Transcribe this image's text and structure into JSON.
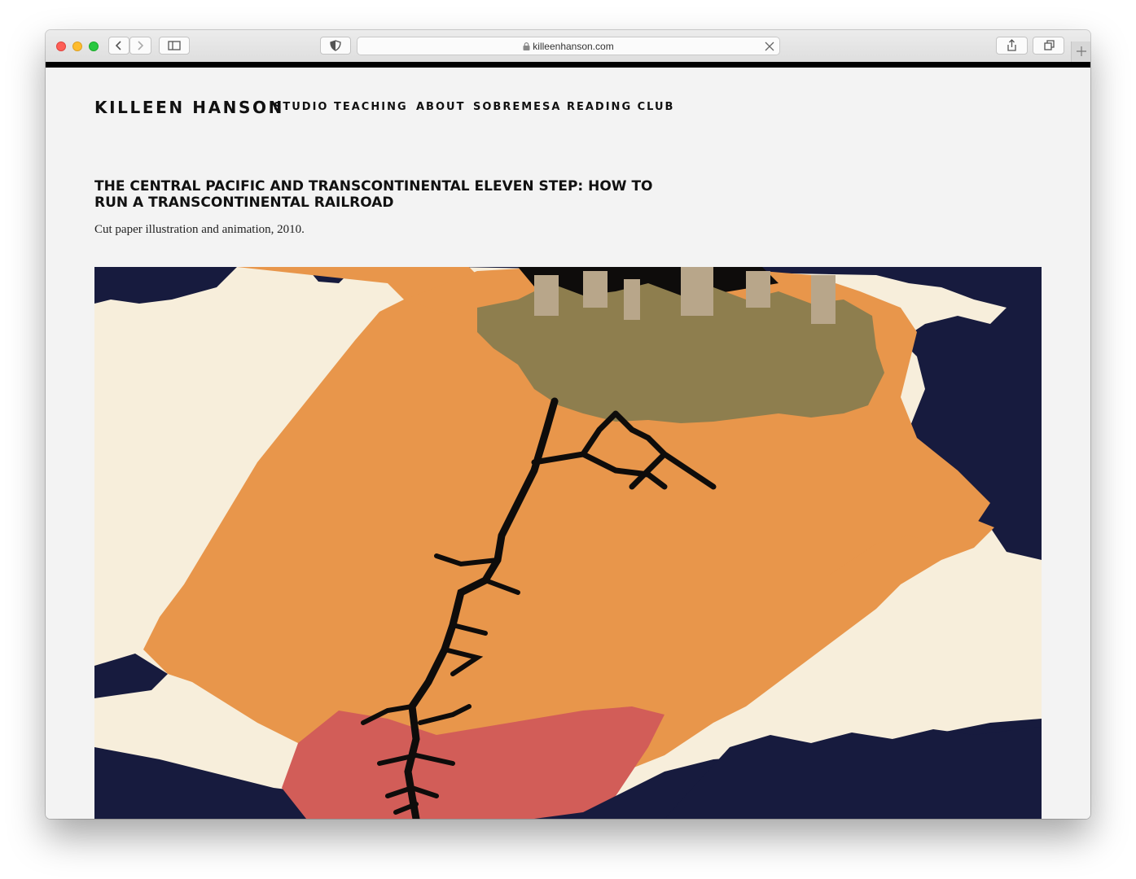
{
  "browser": {
    "url": "killeenhanson.com",
    "colors": {
      "close": "#fe5f57",
      "minimize": "#febc2e",
      "maximize": "#28c840"
    },
    "icons": [
      "close-light",
      "minimize-light",
      "maximize-light",
      "chevron-left-icon",
      "chevron-right-icon",
      "sidebar-icon",
      "privacy-shield-icon",
      "lock-icon",
      "clear-x-icon",
      "share-icon",
      "tabs-icon",
      "plus-icon"
    ]
  },
  "site": {
    "logo": "KILLEEN HANSON",
    "nav": [
      {
        "label": "STUDIO"
      },
      {
        "label": "TEACHING"
      },
      {
        "label": "ABOUT"
      },
      {
        "label": "SOBREMESA READING CLUB"
      }
    ]
  },
  "project": {
    "title": "THE CENTRAL PACIFIC AND TRANSCONTINENTAL ELEVEN STEP: HOW TO RUN A TRANSCONTINENTAL RAILROAD",
    "caption": "Cut paper illustration and animation, 2010.",
    "artwork_colors": {
      "navy": "#171b3e",
      "cream": "#f7eedb",
      "orange": "#e8964b",
      "pink": "#d25d58",
      "black": "#0e0c0b",
      "gold": "#8e7e4e",
      "taupe": "#b8a68a"
    }
  }
}
